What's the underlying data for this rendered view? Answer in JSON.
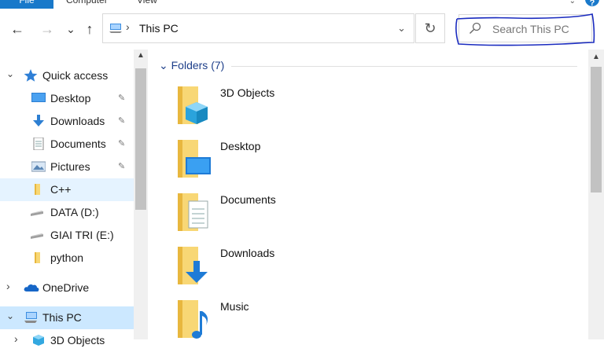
{
  "ribbon": {
    "tabs": [
      {
        "label": "File"
      },
      {
        "label": "Computer"
      },
      {
        "label": "View"
      }
    ],
    "help_label": "?"
  },
  "address_bar": {
    "back_glyph": "←",
    "forward_glyph": "→",
    "recent_glyph": "⌄",
    "up_glyph": "↑",
    "separator": "›",
    "path": "This PC",
    "dropdown_glyph": "⌄",
    "refresh_glyph": "↻"
  },
  "search": {
    "placeholder": "Search This PC"
  },
  "nav_pane": {
    "quick_access": {
      "label": "Quick access",
      "expand_glyph": "⌄",
      "items": [
        {
          "label": "Desktop",
          "icon": "desktop-icon",
          "pinned": true
        },
        {
          "label": "Downloads",
          "icon": "downloads-icon",
          "pinned": true
        },
        {
          "label": "Documents",
          "icon": "documents-icon",
          "pinned": true
        },
        {
          "label": "Pictures",
          "icon": "pictures-icon",
          "pinned": true
        },
        {
          "label": "C++",
          "icon": "folder-icon",
          "pinned": false
        },
        {
          "label": "DATA (D:)",
          "icon": "drive-icon",
          "pinned": false
        },
        {
          "label": "GIAI TRI (E:)",
          "icon": "drive-icon",
          "pinned": false
        },
        {
          "label": "python",
          "icon": "folder-icon",
          "pinned": false
        }
      ]
    },
    "onedrive": {
      "label": "OneDrive",
      "expand_glyph": "›"
    },
    "this_pc": {
      "label": "This PC",
      "expand_glyph": "⌄"
    },
    "this_pc_child": {
      "label": "3D Objects"
    },
    "pin_glyph": "📌"
  },
  "content": {
    "group_label": "Folders (7)",
    "group_glyph": "⌄",
    "folders": [
      {
        "label": "3D Objects",
        "icon": "3d-objects-folder-icon"
      },
      {
        "label": "Desktop",
        "icon": "desktop-folder-icon"
      },
      {
        "label": "Documents",
        "icon": "documents-folder-icon"
      },
      {
        "label": "Downloads",
        "icon": "downloads-folder-icon"
      },
      {
        "label": "Music",
        "icon": "music-folder-icon"
      }
    ]
  },
  "scrollbar": {
    "up_glyph": "▲"
  },
  "colors": {
    "accent": "#1979ca",
    "selection": "#cce8ff",
    "folder_yellow": "#f8d775",
    "heading_blue": "#1e3f8a",
    "annotation_ink": "#1a2bbf"
  }
}
